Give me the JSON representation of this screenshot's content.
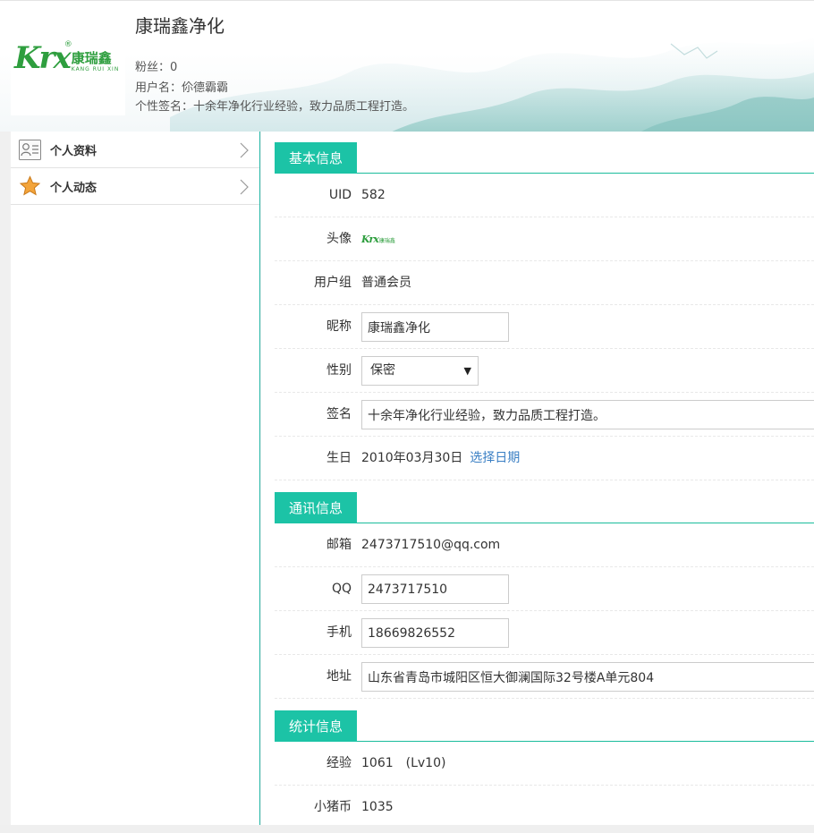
{
  "header": {
    "title": "康瑞鑫净化",
    "fans": "粉丝：0",
    "username": "用户名：伱德霸霸",
    "signature": "个性签名：十余年净化行业经验，致力品质工程打造。",
    "logo": {
      "script": "Krx",
      "reg": "®",
      "cn": "康瑞鑫",
      "en": "KANG RUI XIN",
      "color": "#2e9e3e"
    }
  },
  "sidebar": {
    "items": [
      {
        "label": "个人资料",
        "icon": "profile-card-icon"
      },
      {
        "label": "个人动态",
        "icon": "star-icon"
      }
    ]
  },
  "sections": {
    "basic": "基本信息",
    "contact": "通讯信息",
    "stats": "统计信息"
  },
  "basic": {
    "uid_label": "UID",
    "uid": "582",
    "avatar_label": "头像",
    "avatar_script": "Krx",
    "avatar_cn": "康瑞鑫",
    "group_label": "用户组",
    "group": "普通会员",
    "nickname_label": "昵称",
    "nickname": "康瑞鑫净化",
    "gender_label": "性别",
    "gender": "保密",
    "sign_label": "签名",
    "sign": "十余年净化行业经验，致力品质工程打造。",
    "birthday_label": "生日",
    "birthday": "2010年03月30日",
    "pick_date": "选择日期"
  },
  "contact": {
    "email_label": "邮箱",
    "email": "2473717510@qq.com",
    "qq_label": "QQ",
    "qq": "2473717510",
    "phone_label": "手机",
    "phone": "18669826552",
    "address_label": "地址",
    "address": "山东省青岛市城阳区恒大御澜国际32号楼A单元804"
  },
  "stats": {
    "exp_label": "经验",
    "exp": "1061　(Lv10)",
    "coin_label": "小猪币",
    "coin": "1035"
  },
  "colors": {
    "accent": "#1cc3a6",
    "link": "#3a7fc4",
    "border": "#28b8a8"
  }
}
